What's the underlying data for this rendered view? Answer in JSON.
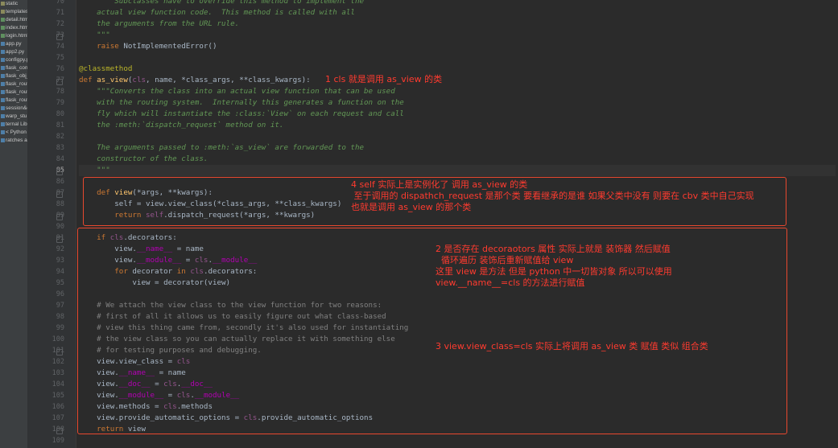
{
  "sidebar": {
    "items": [
      "static",
      "templates",
      "detail.html",
      "index.html",
      "login.html",
      "app.py",
      "app2.py",
      "configpy.py",
      "flask_config",
      "flask_obj_c",
      "flask_route",
      "flask_route",
      "flask_route",
      "session&c",
      "warp_stu.p",
      "ternal Libra",
      "< Python 3",
      "ratches and"
    ]
  },
  "code": {
    "lines": [
      {
        "n": "70",
        "t": [
          [
            "doc",
            "        Subclasses have to override this method to implement the"
          ]
        ]
      },
      {
        "n": "71",
        "t": [
          [
            "doc",
            "    actual view function code.  This method is called with all"
          ]
        ]
      },
      {
        "n": "72",
        "t": [
          [
            "doc",
            "    the arguments from the URL rule."
          ]
        ]
      },
      {
        "n": "73",
        "t": [
          [
            "doc",
            "    \"\"\""
          ]
        ]
      },
      {
        "n": "74",
        "t": [
          [
            "kw",
            "    raise "
          ],
          [
            "txt",
            "NotImplementedError()"
          ]
        ]
      },
      {
        "n": "75",
        "t": [
          [
            "txt",
            ""
          ]
        ]
      },
      {
        "n": "76",
        "t": [
          [
            "dec",
            "@classmethod"
          ]
        ]
      },
      {
        "n": "77",
        "t": [
          [
            "kw",
            "def "
          ],
          [
            "fn",
            "as_view"
          ],
          [
            "txt",
            "("
          ],
          [
            "sc",
            "cls"
          ],
          [
            "txt",
            ", name, *class_args, **class_kwargs):"
          ]
        ]
      },
      {
        "n": "78",
        "t": [
          [
            "doc",
            "    \"\"\"Converts the class into an actual view function that can be used"
          ]
        ]
      },
      {
        "n": "79",
        "t": [
          [
            "doc",
            "    with the routing system.  Internally this generates a function on the"
          ]
        ]
      },
      {
        "n": "80",
        "t": [
          [
            "doc",
            "    fly which will instantiate the :class:`View` on each request and call"
          ]
        ]
      },
      {
        "n": "81",
        "t": [
          [
            "doc",
            "    the :meth:`dispatch_request` method on it."
          ]
        ]
      },
      {
        "n": "82",
        "t": [
          [
            "txt",
            ""
          ]
        ]
      },
      {
        "n": "83",
        "t": [
          [
            "doc",
            "    The arguments passed to :meth:`as_view` are forwarded to the"
          ]
        ]
      },
      {
        "n": "84",
        "t": [
          [
            "doc",
            "    constructor of the class."
          ]
        ]
      },
      {
        "n": "85",
        "t": [
          [
            "doc",
            "    \"\"\""
          ]
        ]
      },
      {
        "n": "86",
        "t": [
          [
            "txt",
            ""
          ]
        ]
      },
      {
        "n": "87",
        "t": [
          [
            "kw",
            "    def "
          ],
          [
            "fn",
            "view"
          ],
          [
            "txt",
            "(*args, **kwargs):"
          ]
        ]
      },
      {
        "n": "88",
        "t": [
          [
            "txt",
            "        self = view.view_class(*class_args, **class_kwargs)"
          ]
        ]
      },
      {
        "n": "89",
        "t": [
          [
            "kw",
            "        return "
          ],
          [
            "sc",
            "self"
          ],
          [
            "txt",
            ".dispatch_request(*args, **kwargs)"
          ]
        ]
      },
      {
        "n": "90",
        "t": [
          [
            "txt",
            ""
          ]
        ]
      },
      {
        "n": "91",
        "t": [
          [
            "kw",
            "    if "
          ],
          [
            "sc",
            "cls"
          ],
          [
            "txt",
            ".decorators:"
          ]
        ]
      },
      {
        "n": "92",
        "t": [
          [
            "txt",
            "        view."
          ],
          [
            "mg",
            "__name__"
          ],
          [
            "txt",
            " = name"
          ]
        ]
      },
      {
        "n": "93",
        "t": [
          [
            "txt",
            "        view."
          ],
          [
            "mg",
            "__module__"
          ],
          [
            "txt",
            " = "
          ],
          [
            "sc",
            "cls"
          ],
          [
            "txt",
            "."
          ],
          [
            "mg",
            "__module__"
          ]
        ]
      },
      {
        "n": "94",
        "t": [
          [
            "kw",
            "        for "
          ],
          [
            "txt",
            "decorator "
          ],
          [
            "kw",
            "in "
          ],
          [
            "sc",
            "cls"
          ],
          [
            "txt",
            ".decorators:"
          ]
        ]
      },
      {
        "n": "95",
        "t": [
          [
            "txt",
            "            view = decorator(view)"
          ]
        ]
      },
      {
        "n": "96",
        "t": [
          [
            "txt",
            ""
          ]
        ]
      },
      {
        "n": "97",
        "t": [
          [
            "cm",
            "    # We attach the view class to the view function for two reasons:"
          ]
        ]
      },
      {
        "n": "98",
        "t": [
          [
            "cm",
            "    # first of all it allows us to easily figure out what class-based"
          ]
        ]
      },
      {
        "n": "99",
        "t": [
          [
            "cm",
            "    # view this thing came from, secondly it's also used for instantiating"
          ]
        ]
      },
      {
        "n": "100",
        "t": [
          [
            "cm",
            "    # the view class so you can actually replace it with something else"
          ]
        ]
      },
      {
        "n": "101",
        "t": [
          [
            "cm",
            "    # for testing purposes and debugging."
          ]
        ]
      },
      {
        "n": "102",
        "t": [
          [
            "txt",
            "    view.view_class = "
          ],
          [
            "sc",
            "cls"
          ]
        ]
      },
      {
        "n": "103",
        "t": [
          [
            "txt",
            "    view."
          ],
          [
            "mg",
            "__name__"
          ],
          [
            "txt",
            " = name"
          ]
        ]
      },
      {
        "n": "104",
        "t": [
          [
            "txt",
            "    view."
          ],
          [
            "mg",
            "__doc__"
          ],
          [
            "txt",
            " = "
          ],
          [
            "sc",
            "cls"
          ],
          [
            "txt",
            "."
          ],
          [
            "mg",
            "__doc__"
          ]
        ]
      },
      {
        "n": "105",
        "t": [
          [
            "txt",
            "    view."
          ],
          [
            "mg",
            "__module__"
          ],
          [
            "txt",
            " = "
          ],
          [
            "sc",
            "cls"
          ],
          [
            "txt",
            "."
          ],
          [
            "mg",
            "__module__"
          ]
        ]
      },
      {
        "n": "106",
        "t": [
          [
            "txt",
            "    view.methods = "
          ],
          [
            "sc",
            "cls"
          ],
          [
            "txt",
            ".methods"
          ]
        ]
      },
      {
        "n": "107",
        "t": [
          [
            "txt",
            "    view.provide_automatic_options = "
          ],
          [
            "sc",
            "cls"
          ],
          [
            "txt",
            ".provide_automatic_options"
          ]
        ]
      },
      {
        "n": "108",
        "t": [
          [
            "kw",
            "    return "
          ],
          [
            "txt",
            "view"
          ]
        ]
      },
      {
        "n": "109",
        "t": [
          [
            "txt",
            ""
          ]
        ]
      }
    ]
  },
  "annotations": {
    "note1": "1 cls 就是调用 as_view 的类",
    "note4_line1": "4 self 实际上是实例化了 调用 as_view 的类",
    "note4_line2": " 至于调用的 dispathch_request 是那个类 要看继承的是谁 如果父类中没有 则要在 cbv 类中自己实现",
    "note4_line3": "也就是调用 as_view 的那个类",
    "note2_line1": "2 是否存在 decoraotors 属性 实际上就是 装饰器 然后赋值",
    "note2_line2": "  循环遍历 装饰后重新赋值给 view",
    "note2_line3": "这里 view 是方法 但是 python 中一切皆对象 所以可以使用",
    "note2_line4": "view.__name__=cls 的方法进行赋值",
    "note3": "3 view.view_class=cls 实际上将调用 as_view 类 赋值 类似 组合类"
  },
  "colors": {
    "background": "#2b2b2b",
    "annotation_red": "#ff3b2f",
    "keyword": "#cc7832",
    "docstring": "#629755",
    "comment": "#808080",
    "self_cls": "#94558d",
    "decorator": "#bbb529",
    "function_name": "#ffc66d",
    "magic": "#b200b2"
  },
  "current_line": "85"
}
